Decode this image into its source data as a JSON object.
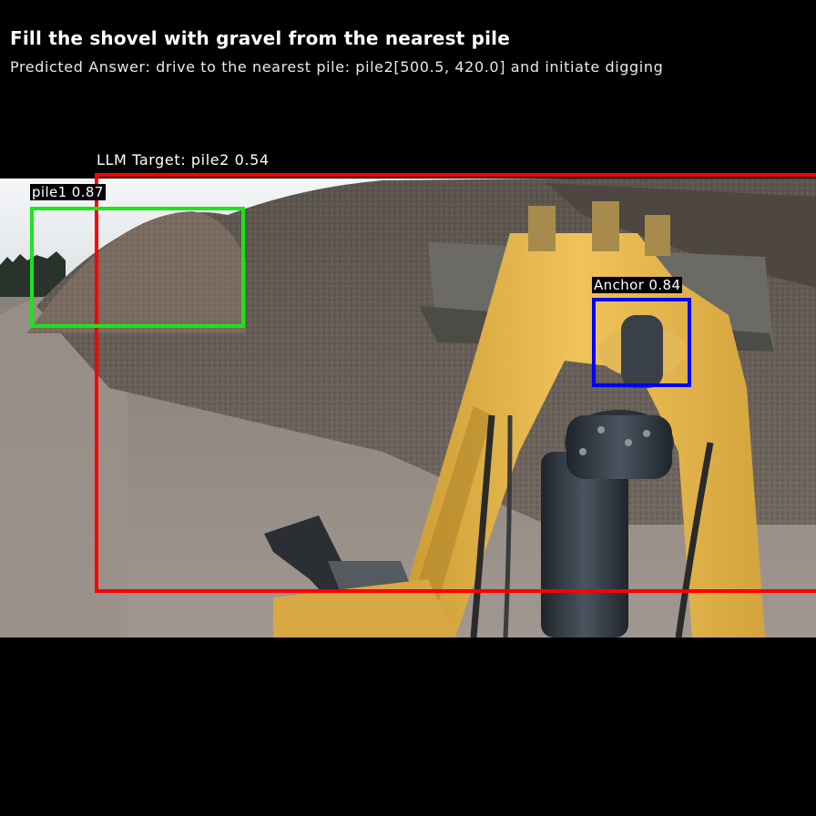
{
  "header": {
    "title": "Fill the shovel with gravel from the nearest pile",
    "predicted_answer": "Predicted Answer: drive to the nearest pile: pile2[500.5, 420.0] and initiate digging"
  },
  "detections": {
    "target_label": "LLM Target: pile2 0.54",
    "pile1_label": "pile1 0.87",
    "anchor_label": "Anchor 0.84"
  },
  "colors": {
    "target_box": "#ff0000",
    "pile1_box": "#1be41b",
    "anchor_box": "#0000ff",
    "machine_yellow": "#e6b54a",
    "gravel": "#6d655c"
  }
}
